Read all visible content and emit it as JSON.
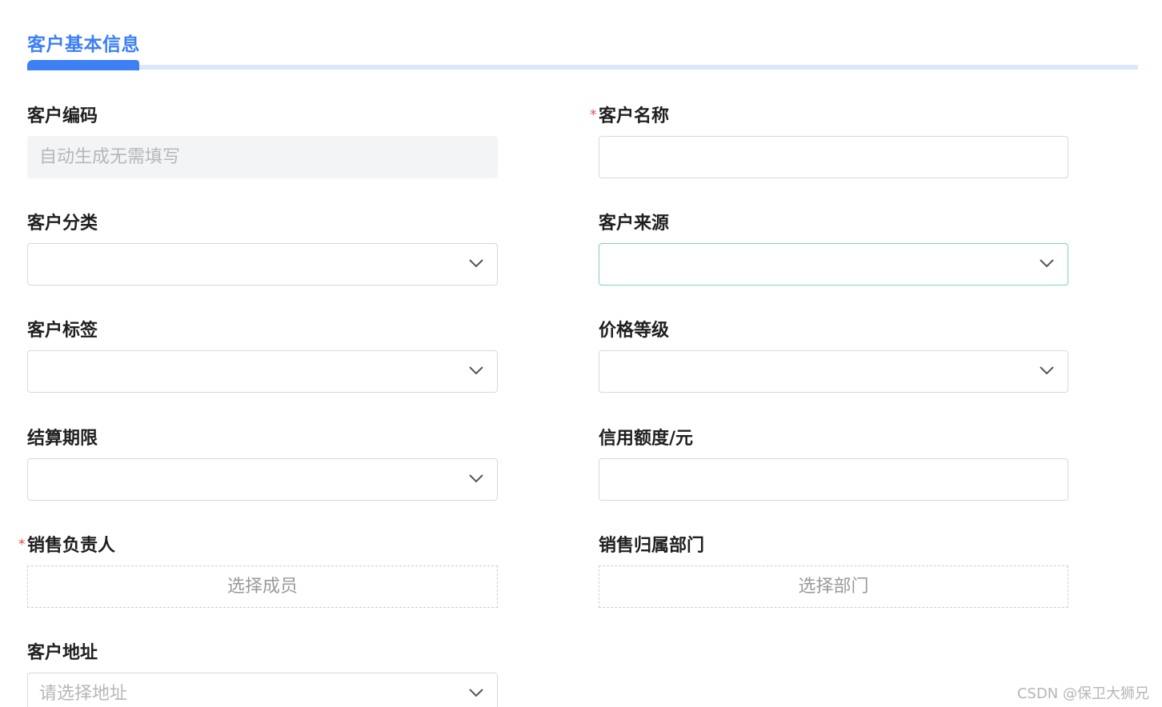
{
  "section": {
    "title": "客户基本信息"
  },
  "fields": {
    "customer_code": {
      "label": "客户编码",
      "placeholder": "自动生成无需填写"
    },
    "customer_name": {
      "required_mark": "*",
      "label": "客户名称"
    },
    "customer_category": {
      "label": "客户分类"
    },
    "customer_source": {
      "label": "客户来源"
    },
    "customer_tags": {
      "label": "客户标签"
    },
    "price_level": {
      "label": "价格等级"
    },
    "settlement_period": {
      "label": "结算期限"
    },
    "credit_limit": {
      "label": "信用额度/元"
    },
    "sales_owner": {
      "required_mark": "*",
      "label": "销售负责人",
      "button": "选择成员"
    },
    "sales_department": {
      "label": "销售归属部门",
      "button": "选择部门"
    },
    "customer_address": {
      "label": "客户地址",
      "placeholder": "请选择地址"
    }
  },
  "watermark": "CSDN @保卫大狮兄",
  "icons": {
    "dropdown": "chevron-down-icon"
  },
  "colors": {
    "accent": "#3d7ff5",
    "accent_track": "#dbe8fb",
    "required": "#e5484d",
    "focus_border": "#7fd1bf",
    "disabled_bg": "#f3f4f6"
  }
}
